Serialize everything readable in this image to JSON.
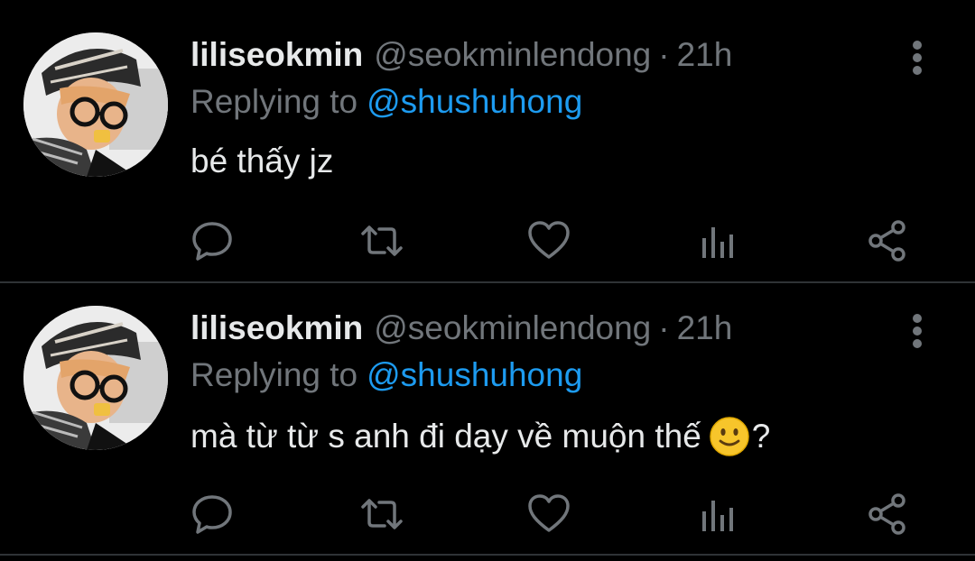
{
  "tweets": [
    {
      "display_name": "liliseokmin",
      "handle": "@seokminlendong",
      "separator": "·",
      "time": "21h",
      "reply_prefix": "Replying to",
      "reply_target": "@shushuhong",
      "text": "bé thấy jz",
      "emoji": "",
      "text_after": ""
    },
    {
      "display_name": "liliseokmin",
      "handle": "@seokminlendong",
      "separator": "·",
      "time": "21h",
      "reply_prefix": "Replying to",
      "reply_target": "@shushuhong",
      "text": "mà từ từ s anh đi dạy về muộn thế",
      "emoji": "slightly-smiling-face-emoji",
      "text_after": "?"
    }
  ],
  "icons": {
    "more": "vertical-ellipsis-icon",
    "reply": "reply-bubble-icon",
    "retweet": "retweet-icon",
    "like": "heart-icon",
    "views": "analytics-bars-icon",
    "share": "share-icon"
  },
  "colors": {
    "background": "#000000",
    "primary_text": "#e7e9ea",
    "secondary_text": "#71767b",
    "accent_link": "#1d9bf0",
    "divider": "#2f3336",
    "icon": "#71767b"
  }
}
